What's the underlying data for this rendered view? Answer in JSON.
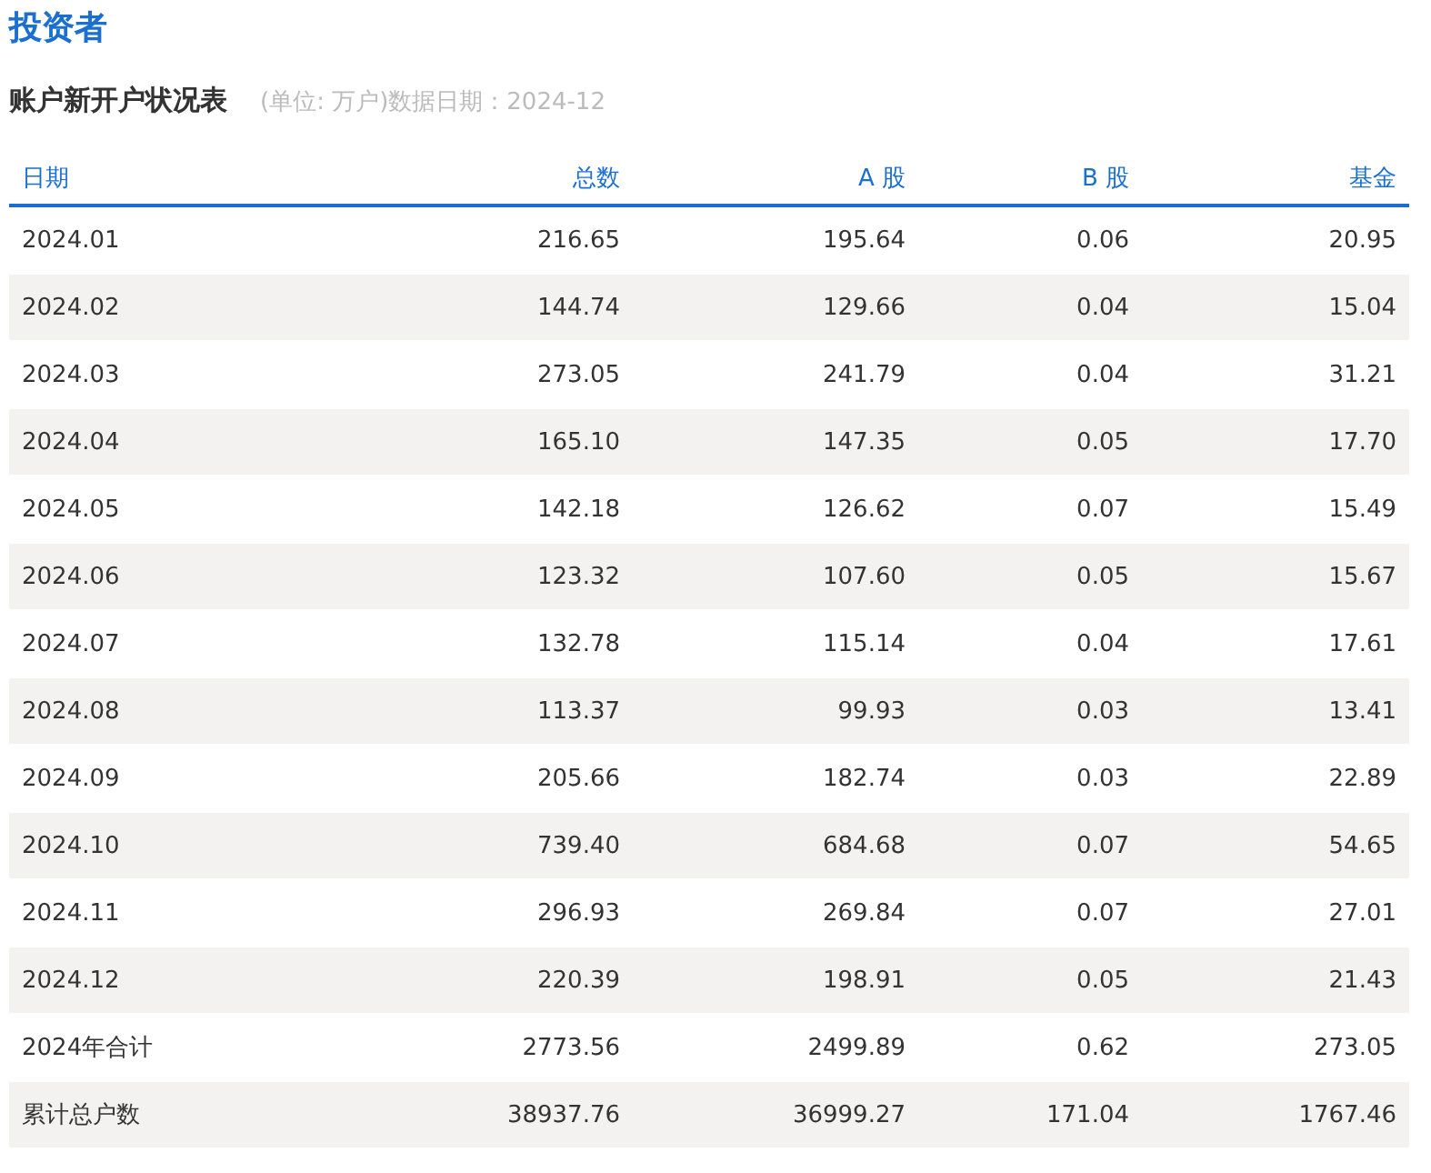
{
  "page_title": "投资者",
  "table_title": "账户新开户状况表",
  "table_note": "(单位: 万户)数据日期：2024-12",
  "table": {
    "columns": [
      "日期",
      "总数",
      "A 股",
      "B 股",
      "基金"
    ],
    "rows": [
      [
        "2024.01",
        "216.65",
        "195.64",
        "0.06",
        "20.95"
      ],
      [
        "2024.02",
        "144.74",
        "129.66",
        "0.04",
        "15.04"
      ],
      [
        "2024.03",
        "273.05",
        "241.79",
        "0.04",
        "31.21"
      ],
      [
        "2024.04",
        "165.10",
        "147.35",
        "0.05",
        "17.70"
      ],
      [
        "2024.05",
        "142.18",
        "126.62",
        "0.07",
        "15.49"
      ],
      [
        "2024.06",
        "123.32",
        "107.60",
        "0.05",
        "15.67"
      ],
      [
        "2024.07",
        "132.78",
        "115.14",
        "0.04",
        "17.61"
      ],
      [
        "2024.08",
        "113.37",
        "99.93",
        "0.03",
        "13.41"
      ],
      [
        "2024.09",
        "205.66",
        "182.74",
        "0.03",
        "22.89"
      ],
      [
        "2024.10",
        "739.40",
        "684.68",
        "0.07",
        "54.65"
      ],
      [
        "2024.11",
        "296.93",
        "269.84",
        "0.07",
        "27.01"
      ],
      [
        "2024.12",
        "220.39",
        "198.91",
        "0.05",
        "21.43"
      ],
      [
        "2024年合计",
        "2773.56",
        "2499.89",
        "0.62",
        "273.05"
      ],
      [
        "累计总户数",
        "38937.76",
        "36999.27",
        "171.04",
        "1767.46"
      ]
    ]
  }
}
